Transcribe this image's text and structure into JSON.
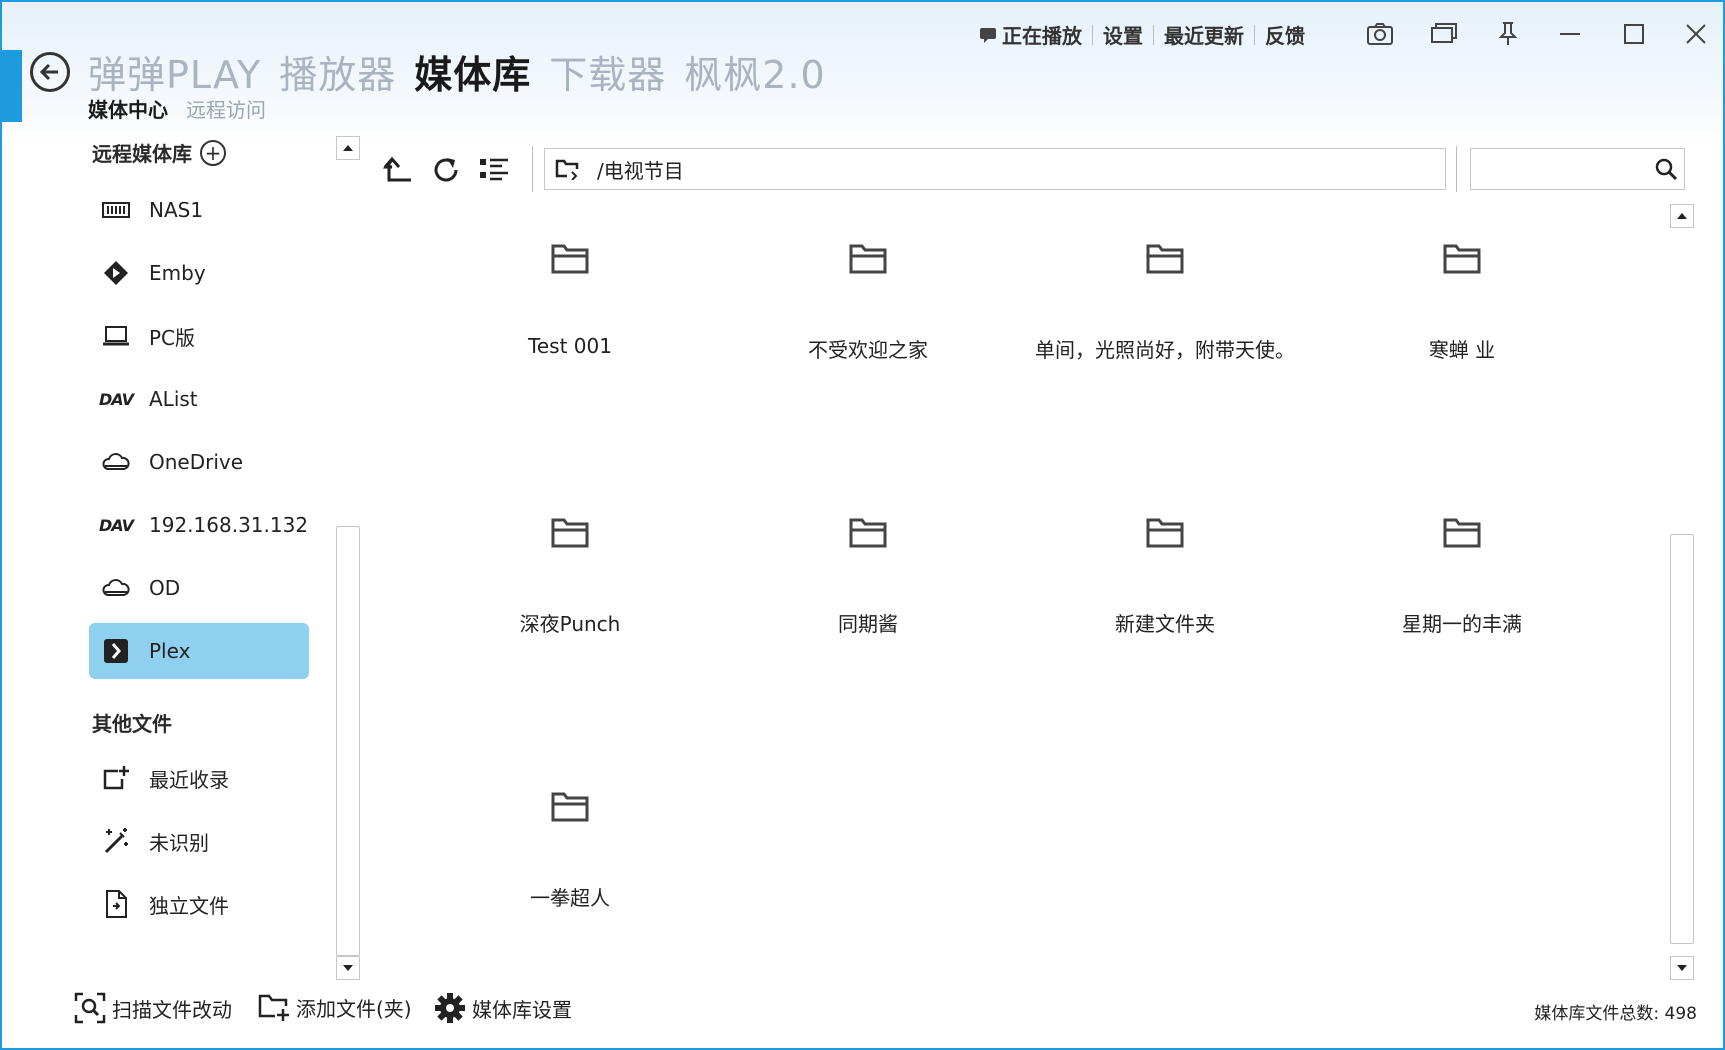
{
  "topmenu": {
    "now_playing": "正在播放",
    "settings": "设置",
    "recent_updates": "最近更新",
    "feedback": "反馈"
  },
  "title_tabs": [
    "弹弹PLAY",
    "播放器",
    "媒体库",
    "下载器",
    "枫枫2.0"
  ],
  "active_title_tab": "媒体库",
  "sub_tabs": [
    "媒体中心",
    "远程访问"
  ],
  "sidebar": {
    "remote_title": "远程媒体库",
    "remote_items": [
      {
        "label": "NAS1",
        "icon": "nas-icon"
      },
      {
        "label": "Emby",
        "icon": "emby-icon"
      },
      {
        "label": "PC版",
        "icon": "laptop-icon"
      },
      {
        "label": "AList",
        "icon": "dav-icon"
      },
      {
        "label": "OneDrive",
        "icon": "cloud-icon"
      },
      {
        "label": "192.168.31.132",
        "icon": "dav-icon"
      },
      {
        "label": "OD",
        "icon": "cloud-icon"
      },
      {
        "label": "Plex",
        "icon": "plex-icon"
      }
    ],
    "selected": "Plex",
    "other_title": "其他文件",
    "other_items": [
      {
        "label": "最近收录",
        "icon": "recent-add-icon"
      },
      {
        "label": "未识别",
        "icon": "magic-wand-icon"
      },
      {
        "label": "独立文件",
        "icon": "file-icon"
      }
    ]
  },
  "path": "/电视节目",
  "search": {
    "value": "",
    "placeholder": ""
  },
  "folders": [
    "Test 001",
    "不受欢迎之家",
    "单间，光照尚好，附带天使。",
    "寒蝉 业",
    "深夜Punch",
    "同期酱",
    "新建文件夹",
    "星期一的丰满",
    "一拳超人"
  ],
  "bottom": {
    "scan": "扫描文件改动",
    "add": "添加文件(夹)",
    "settings": "媒体库设置",
    "total": "媒体库文件总数: 498"
  },
  "colors": {
    "accent": "#1e9bdf",
    "selected": "#8fd0f0"
  }
}
